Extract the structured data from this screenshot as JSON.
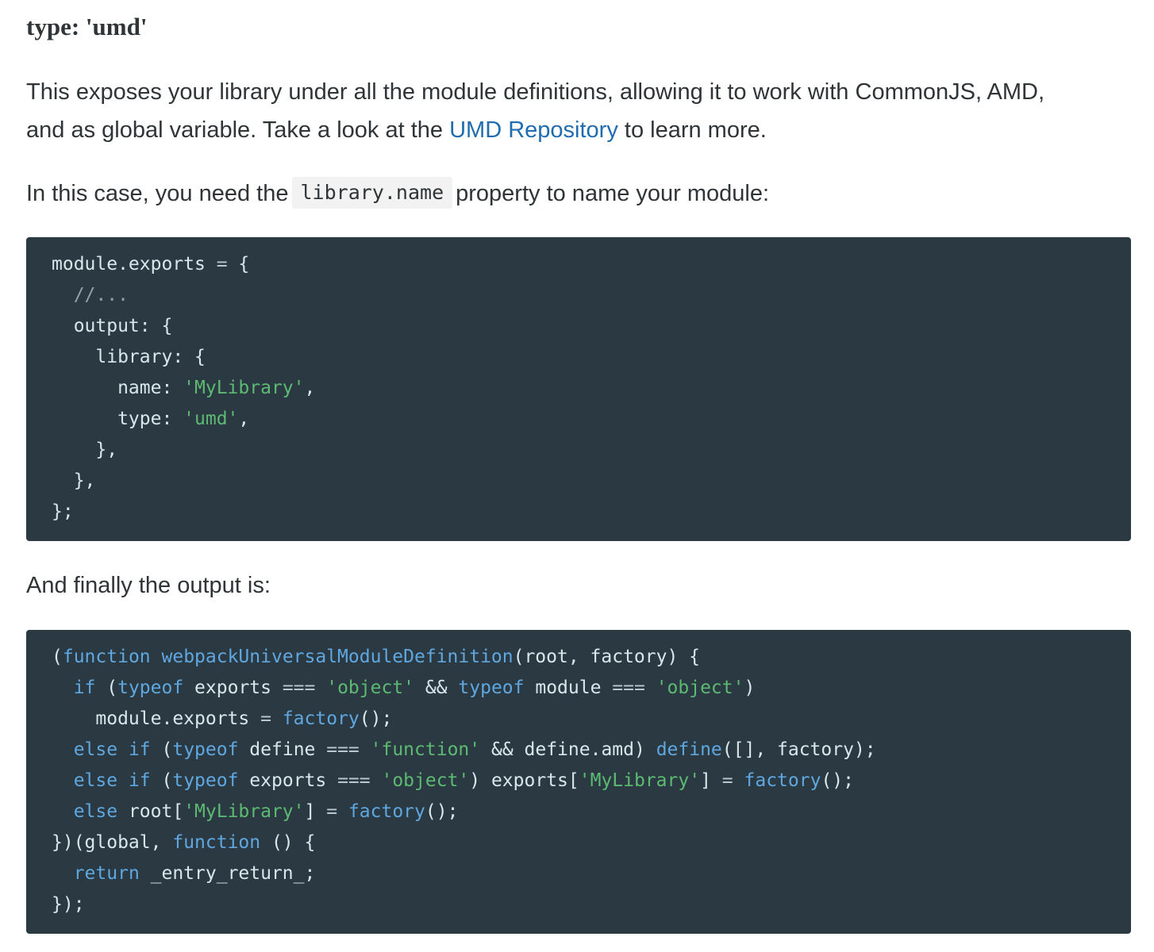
{
  "section": {
    "heading": "type: 'umd'",
    "intro_line_1": "This exposes your library under all the module definitions, allowing it to work with CommonJS, AMD,",
    "intro_line_2_prefix": "and as global variable. Take a look at the ",
    "intro_link": "UMD Repository",
    "intro_line_2_suffix": " to learn more.",
    "case_prefix": "In this case, you need the",
    "case_code": "library.name",
    "case_suffix": "property to name your module:",
    "output_intro": "And finally the output is:"
  },
  "config_code": [
    [
      {
        "t": "module.exports "
      },
      {
        "t": "=",
        "c": "op"
      },
      {
        "t": " {"
      }
    ],
    [
      {
        "t": "  "
      },
      {
        "t": "//...",
        "c": "cm"
      }
    ],
    [
      {
        "t": "  output: {"
      }
    ],
    [
      {
        "t": "    library: {"
      }
    ],
    [
      {
        "t": "      name: "
      },
      {
        "t": "'MyLibrary'",
        "c": "str"
      },
      {
        "t": ","
      }
    ],
    [
      {
        "t": "      type: "
      },
      {
        "t": "'umd'",
        "c": "str"
      },
      {
        "t": ","
      }
    ],
    [
      {
        "t": "    },"
      }
    ],
    [
      {
        "t": "  },"
      }
    ],
    [
      {
        "t": "};"
      }
    ]
  ],
  "output_code": [
    [
      {
        "t": "("
      },
      {
        "t": "function",
        "c": "kw"
      },
      {
        "t": " "
      },
      {
        "t": "webpackUniversalModuleDefinition",
        "c": "fn"
      },
      {
        "t": "(root, factory) {"
      }
    ],
    [
      {
        "t": "  "
      },
      {
        "t": "if",
        "c": "kw"
      },
      {
        "t": " ("
      },
      {
        "t": "typeof",
        "c": "kw"
      },
      {
        "t": " exports "
      },
      {
        "t": "===",
        "c": "op"
      },
      {
        "t": " "
      },
      {
        "t": "'object'",
        "c": "str"
      },
      {
        "t": " && "
      },
      {
        "t": "typeof",
        "c": "kw"
      },
      {
        "t": " module "
      },
      {
        "t": "===",
        "c": "op"
      },
      {
        "t": " "
      },
      {
        "t": "'object'",
        "c": "str"
      },
      {
        "t": ")"
      }
    ],
    [
      {
        "t": "    module.exports "
      },
      {
        "t": "=",
        "c": "op"
      },
      {
        "t": " "
      },
      {
        "t": "factory",
        "c": "fn"
      },
      {
        "t": "();"
      }
    ],
    [
      {
        "t": "  "
      },
      {
        "t": "else",
        "c": "kw"
      },
      {
        "t": " "
      },
      {
        "t": "if",
        "c": "kw"
      },
      {
        "t": " ("
      },
      {
        "t": "typeof",
        "c": "kw"
      },
      {
        "t": " define "
      },
      {
        "t": "===",
        "c": "op"
      },
      {
        "t": " "
      },
      {
        "t": "'function'",
        "c": "str"
      },
      {
        "t": " && define.amd) "
      },
      {
        "t": "define",
        "c": "fn"
      },
      {
        "t": "([], factory);"
      }
    ],
    [
      {
        "t": "  "
      },
      {
        "t": "else",
        "c": "kw"
      },
      {
        "t": " "
      },
      {
        "t": "if",
        "c": "kw"
      },
      {
        "t": " ("
      },
      {
        "t": "typeof",
        "c": "kw"
      },
      {
        "t": " exports "
      },
      {
        "t": "===",
        "c": "op"
      },
      {
        "t": " "
      },
      {
        "t": "'object'",
        "c": "str"
      },
      {
        "t": ") exports["
      },
      {
        "t": "'MyLibrary'",
        "c": "str"
      },
      {
        "t": "] "
      },
      {
        "t": "=",
        "c": "op"
      },
      {
        "t": " "
      },
      {
        "t": "factory",
        "c": "fn"
      },
      {
        "t": "();"
      }
    ],
    [
      {
        "t": "  "
      },
      {
        "t": "else",
        "c": "kw"
      },
      {
        "t": " root["
      },
      {
        "t": "'MyLibrary'",
        "c": "str"
      },
      {
        "t": "] "
      },
      {
        "t": "=",
        "c": "op"
      },
      {
        "t": " "
      },
      {
        "t": "factory",
        "c": "fn"
      },
      {
        "t": "();"
      }
    ],
    [
      {
        "t": "})(global, "
      },
      {
        "t": "function",
        "c": "kw"
      },
      {
        "t": " () {"
      }
    ],
    [
      {
        "t": "  "
      },
      {
        "t": "return",
        "c": "kw"
      },
      {
        "t": " _entry_return_;"
      }
    ],
    [
      {
        "t": "});"
      }
    ]
  ]
}
